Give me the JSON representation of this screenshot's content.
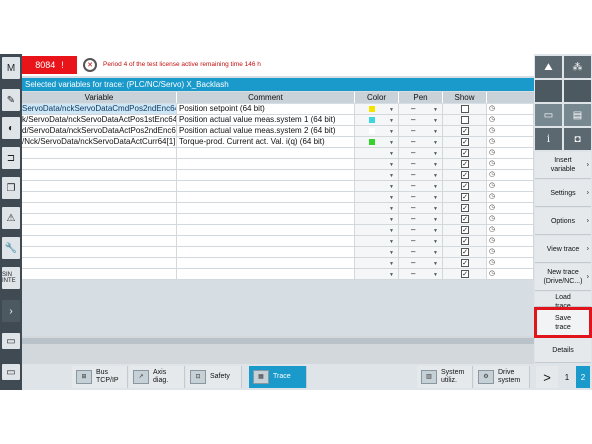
{
  "alarm": {
    "number": "8084",
    "flag": "!",
    "text": "Period 4 of the test license active remaining time 146 h"
  },
  "title": "Selected variables for trace:  (PLC/NC/Servo) X_Backlash",
  "columns": {
    "variable": "Variable",
    "comment": "Comment",
    "color": "Color",
    "pen": "Pen",
    "show": "Show"
  },
  "rows": [
    {
      "variable": "ServoData/nckServoDataCmdPos2ndEnc64[1]",
      "comment": "Position setpoint (64 bit)",
      "color": "#f5e400",
      "pen": "–",
      "show": false,
      "selected": true
    },
    {
      "variable": "k/ServoData/nckServoDataActPos1stEnc64[1]",
      "comment": "Position actual value meas.system 1 (64 bit)",
      "color": "#3dd6e0",
      "pen": "–",
      "show": false,
      "selected": false
    },
    {
      "variable": "d/ServoData/nckServoDataActPos2ndEnc64[1]",
      "comment": "Position actual value meas.system 2 (64 bit)",
      "color": "#ffffff",
      "pen": "–",
      "show": true,
      "selected": false
    },
    {
      "variable": "/Nck/ServoData/nckServoDataActCurr64[1]",
      "comment": "Torque-prod. Current act. Val. i(q) (64 bit)",
      "color": "#35d32b",
      "pen": "–",
      "show": true,
      "selected": false
    },
    {
      "variable": "",
      "comment": "",
      "color": "",
      "pen": "–",
      "show": true,
      "selected": false
    },
    {
      "variable": "",
      "comment": "",
      "color": "",
      "pen": "–",
      "show": true,
      "selected": false
    },
    {
      "variable": "",
      "comment": "",
      "color": "",
      "pen": "–",
      "show": true,
      "selected": false
    },
    {
      "variable": "",
      "comment": "",
      "color": "",
      "pen": "–",
      "show": true,
      "selected": false
    },
    {
      "variable": "",
      "comment": "",
      "color": "",
      "pen": "–",
      "show": true,
      "selected": false
    },
    {
      "variable": "",
      "comment": "",
      "color": "",
      "pen": "–",
      "show": true,
      "selected": false
    },
    {
      "variable": "",
      "comment": "",
      "color": "",
      "pen": "–",
      "show": true,
      "selected": false
    },
    {
      "variable": "",
      "comment": "",
      "color": "",
      "pen": "–",
      "show": true,
      "selected": false
    },
    {
      "variable": "",
      "comment": "",
      "color": "",
      "pen": "–",
      "show": true,
      "selected": false
    },
    {
      "variable": "",
      "comment": "",
      "color": "",
      "pen": "–",
      "show": true,
      "selected": false
    },
    {
      "variable": "",
      "comment": "",
      "color": "",
      "pen": "–",
      "show": true,
      "selected": false
    },
    {
      "variable": "",
      "comment": "",
      "color": "",
      "pen": "–",
      "show": true,
      "selected": false
    }
  ],
  "softkeys": {
    "insert_variable": "Insert variable",
    "settings": "Settings",
    "options": "Options",
    "view_trace": "View trace",
    "new_trace": "New trace (Drive/NC...)",
    "load_trace": "Load trace",
    "save_trace": "Save trace",
    "details": "Details",
    "info": "i"
  },
  "bottom": {
    "bus": "Bus TCP/IP",
    "axis": "Axis diag.",
    "safety": "Safety",
    "trace": "Trace",
    "system": "System utiliz.",
    "drive": "Drive system",
    "next": ">",
    "page1": "1",
    "page2": "2"
  },
  "left": {
    "sinumerik": "SIN INTE"
  },
  "colors": {
    "accent": "#1a9acb",
    "alarm": "#e8141a",
    "highlight": "#e1141b"
  }
}
